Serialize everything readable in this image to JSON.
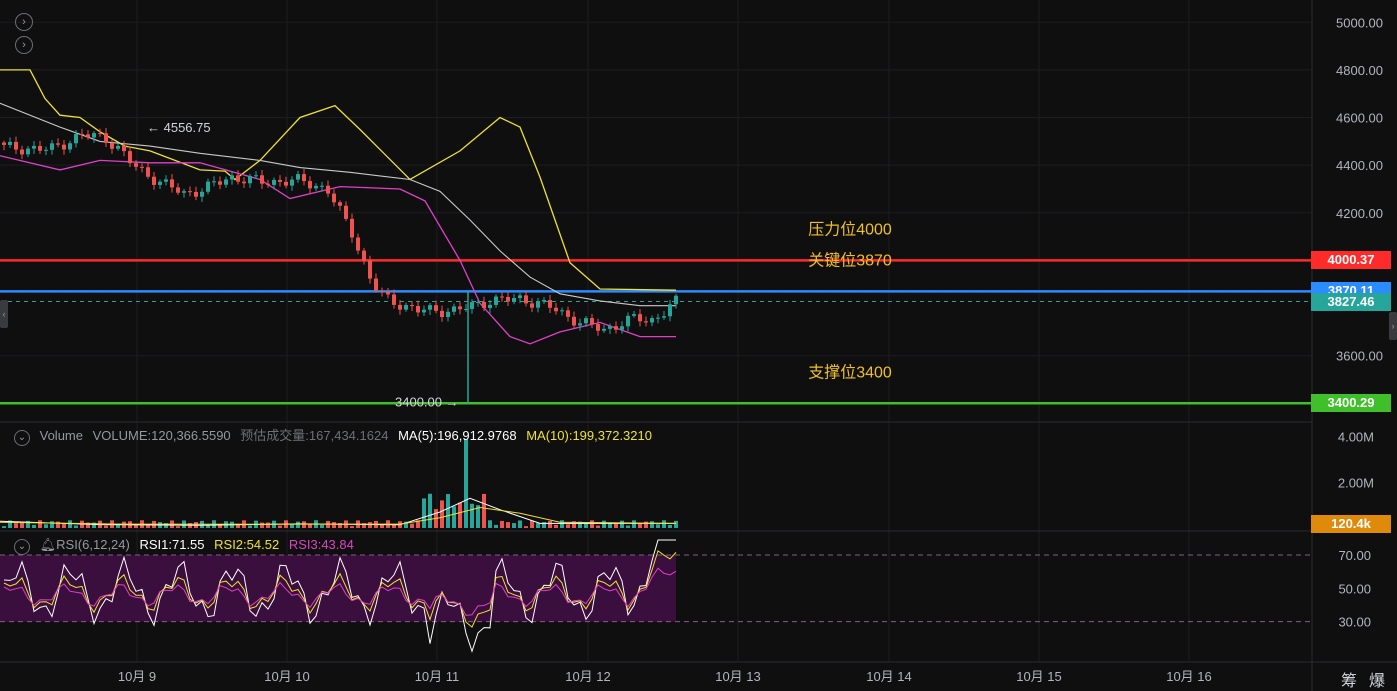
{
  "chart_data": [
    {
      "type": "candlestick",
      "indicators": [
        "Bollinger Bands"
      ],
      "y_axis_ticks": [
        "5000.00",
        "4800.00",
        "4600.00",
        "4400.00",
        "4200.00",
        "3600.00"
      ],
      "ylim": [
        3330,
        5060
      ],
      "x_axis_ticks": [
        "10月 9",
        "10月 10",
        "10月 11",
        "10月 12",
        "10月 13",
        "10月 14",
        "10月 15",
        "10月 16"
      ],
      "high_marker": "← 4556.75",
      "low_marker": "3400.00 →",
      "horizontal_levels": [
        {
          "name": "压力位4000",
          "value": 4000.37,
          "tag": "4000.37",
          "color": "#ff2a2a"
        },
        {
          "name": "关键位3870",
          "value": 3870.11,
          "tag": "3870.11",
          "color": "#2a8cff"
        },
        {
          "name": "支撑位3400",
          "value": 3400.29,
          "tag": "3400.29",
          "color": "#3fbf2a"
        }
      ],
      "last_price": {
        "value": 3827.46,
        "tag": "3827.46",
        "color": "#26a69a"
      }
    },
    {
      "type": "bar",
      "title": "Volume",
      "legend": {
        "name": "Volume",
        "volume": "VOLUME:120,366.5590",
        "estimate": "预估成交量:167,434.1624",
        "ma5": "MA(5):196,912.9768",
        "ma10": "MA(10):199,372.3210"
      },
      "y_axis_ticks": [
        "4.00M",
        "2.00M"
      ],
      "ylim": [
        0,
        4600000
      ],
      "last_tag": "120.4k"
    },
    {
      "type": "line",
      "title": "RSI(6,12,24)",
      "legend": {
        "name": "RSI(6,12,24)",
        "rsi1": "RSI1:71.55",
        "rsi2": "RSI2:54.52",
        "rsi3": "RSI3:43.84"
      },
      "y_axis_ticks": [
        "70.00",
        "50.00",
        "30.00"
      ],
      "ylim": [
        7,
        82
      ],
      "band": [
        30,
        70
      ]
    }
  ],
  "corner_labels": {
    "left": "筹",
    "right": "爆"
  },
  "colors": {
    "up": "#26a69a",
    "down": "#ef5350",
    "boll_upper": "#f0e130",
    "boll_mid": "#c9c9c9",
    "boll_lower": "#e040c8",
    "rsi1": "#ffffff",
    "rsi2": "#f0e130",
    "rsi3": "#e040c8",
    "rsi_band": "#3a0f3d"
  }
}
